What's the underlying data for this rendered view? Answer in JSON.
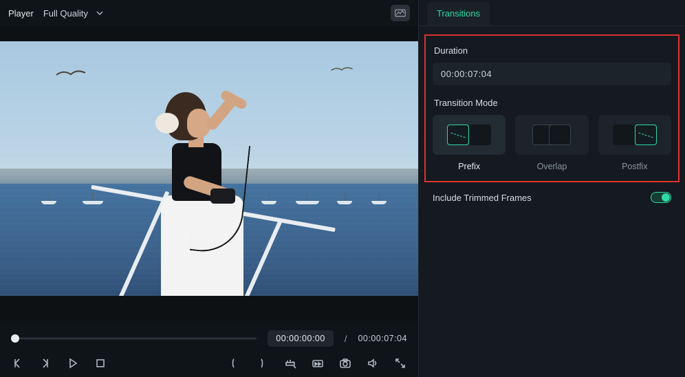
{
  "player": {
    "label": "Player",
    "quality": "Full Quality",
    "current_time": "00:00:00:00",
    "total_time": "00:00:07:04"
  },
  "tab": {
    "transitions": "Transitions"
  },
  "duration": {
    "label": "Duration",
    "value": "00:00:07:04"
  },
  "transition_mode": {
    "label": "Transition Mode",
    "options": {
      "prefix": "Prefix",
      "overlap": "Overlap",
      "postfix": "Postfix"
    }
  },
  "include_trimmed": {
    "label": "Include Trimmed Frames",
    "value": true
  }
}
